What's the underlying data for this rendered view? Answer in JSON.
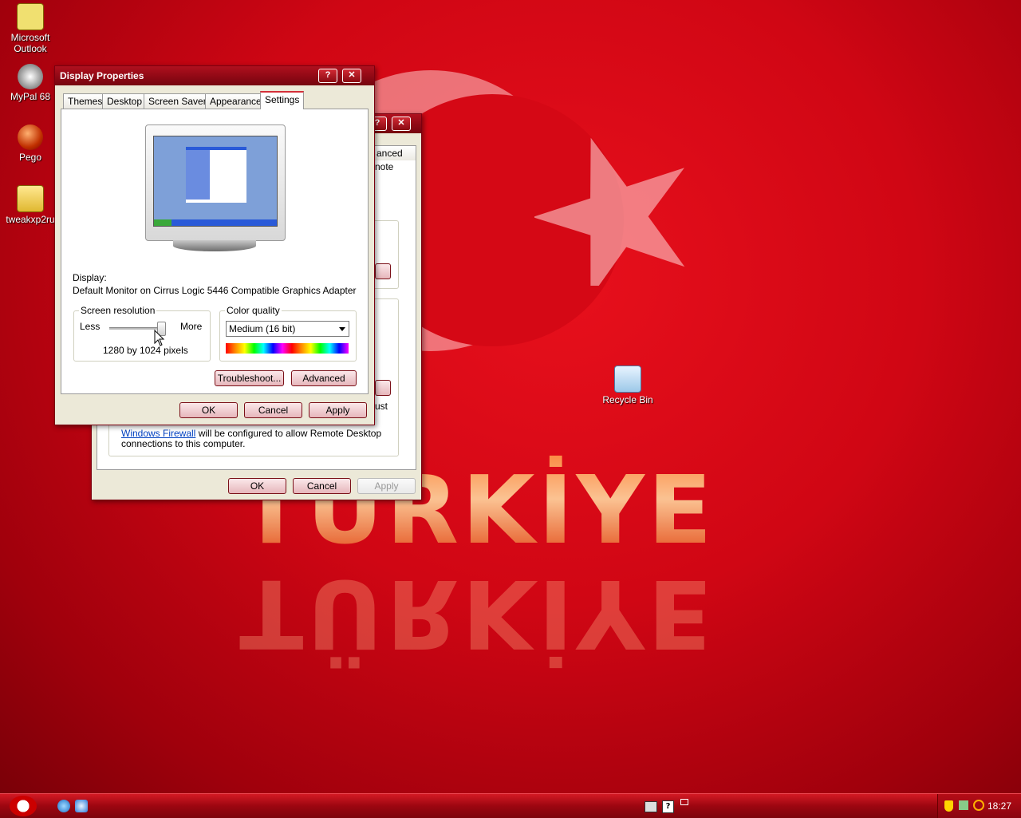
{
  "desktop": {
    "icons": [
      {
        "label_line1": "Microsoft",
        "label_line2": "Outlook",
        "icon": "outlook-icon"
      },
      {
        "label_line1": "MyPal 68",
        "label_line2": "",
        "icon": "mypal-icon"
      },
      {
        "label_line1": "Pego",
        "label_line2": "",
        "icon": "pego-icon"
      },
      {
        "label_line1": "tweakxp2ru",
        "label_line2": "",
        "icon": "zip-folder-icon"
      }
    ],
    "recycle_bin": "Recycle Bin",
    "wallpaper_text": "TÜRKİYE"
  },
  "back_window": {
    "tab_partial": "anced",
    "text_partial_1": "note",
    "text_partial_2": "ust",
    "firewall_link": "Windows Firewall",
    "firewall_text": " will be configured to allow Remote Desktop",
    "firewall_text2": "connections to this computer.",
    "ok": "OK",
    "cancel": "Cancel",
    "apply": "Apply",
    "help": "?",
    "close": "✕"
  },
  "display_properties": {
    "title": "Display Properties",
    "help": "?",
    "close": "✕",
    "tabs": [
      "Themes",
      "Desktop",
      "Screen Saver",
      "Appearance",
      "Settings"
    ],
    "active_tab": "Settings",
    "display_label": "Display:",
    "display_value": "Default Monitor on Cirrus Logic 5446 Compatible Graphics Adapter",
    "screen_resolution": {
      "label": "Screen resolution",
      "less": "Less",
      "more": "More",
      "value_text": "1280 by 1024 pixels",
      "slider_position": 1.0
    },
    "color_quality": {
      "label": "Color quality",
      "selected": "Medium (16 bit)"
    },
    "troubleshoot": "Troubleshoot...",
    "advanced": "Advanced",
    "ok": "OK",
    "cancel": "Cancel",
    "apply": "Apply"
  },
  "taskbar": {
    "clock": "18:27"
  },
  "colors": {
    "accent": "#c00010",
    "title_bar": "#8c0814"
  }
}
